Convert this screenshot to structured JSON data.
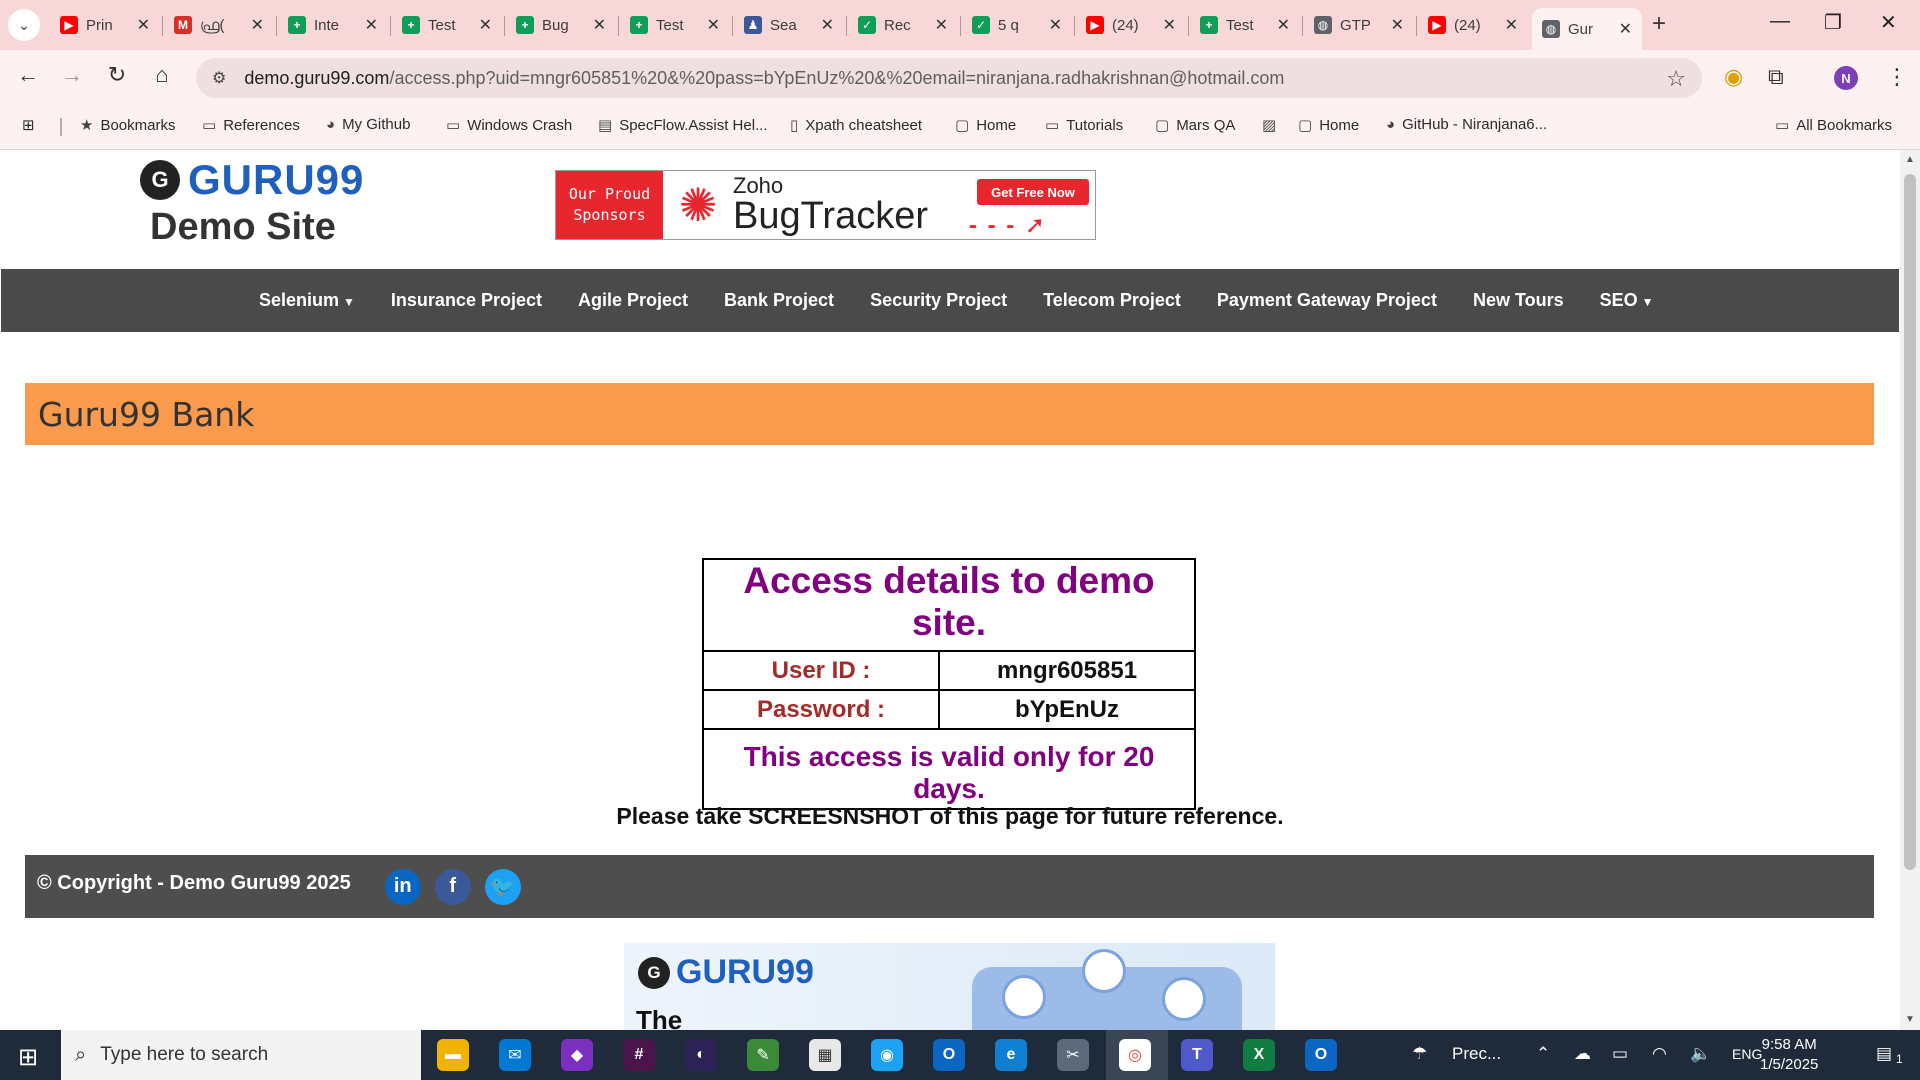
{
  "browser": {
    "tabs": [
      {
        "label": "Prin",
        "icon": "youtube-icon",
        "color": "#ff0000"
      },
      {
        "label": "ഫ്ര(",
        "icon": "gmail-icon",
        "color": "#d93025"
      },
      {
        "label": "Inte",
        "icon": "sheets-icon",
        "color": "#0f9d58"
      },
      {
        "label": "Test",
        "icon": "sheets-icon",
        "color": "#0f9d58"
      },
      {
        "label": "Bug",
        "icon": "sheets-icon",
        "color": "#0f9d58"
      },
      {
        "label": "Test",
        "icon": "sheets-icon",
        "color": "#0f9d58"
      },
      {
        "label": "Sea",
        "icon": "person-icon",
        "color": "#3b5998"
      },
      {
        "label": "Rec",
        "icon": "quiz-icon",
        "color": "#0f9d58"
      },
      {
        "label": "5 q",
        "icon": "quiz-icon",
        "color": "#0f9d58"
      },
      {
        "label": "(24)",
        "icon": "youtube-icon",
        "color": "#ff0000"
      },
      {
        "label": "Test",
        "icon": "sheets-icon",
        "color": "#0f9d58"
      },
      {
        "label": "GTP",
        "icon": "globe-icon",
        "color": "#5f6368"
      },
      {
        "label": "(24)",
        "icon": "youtube-icon",
        "color": "#ff0000"
      },
      {
        "label": "Gur",
        "icon": "globe-icon",
        "color": "#5f6368"
      }
    ],
    "url_host": "demo.guru99.com",
    "url_rest": "/access.php?uid=mngr605851%20&%20pass=bYpEnUz%20&%20email=niranjana.radhakrishnan@hotmail.com",
    "profile_initial": "N",
    "bookmarks": [
      {
        "label": "Bookmarks",
        "icon": "star-icon"
      },
      {
        "label": "References",
        "icon": "folder-icon"
      },
      {
        "label": "My Github",
        "icon": "github-icon"
      },
      {
        "label": "Windows Crash",
        "icon": "folder-icon"
      },
      {
        "label": "SpecFlow.Assist Hel...",
        "icon": "doc-icon"
      },
      {
        "label": "Xpath cheatsheet",
        "icon": "bookmark-icon"
      },
      {
        "label": "Home",
        "icon": "page-icon"
      },
      {
        "label": "Tutorials",
        "icon": "folder-icon"
      },
      {
        "label": "Mars QA",
        "icon": "page-icon"
      },
      {
        "label": "",
        "icon": "image-icon"
      },
      {
        "label": "Home",
        "icon": "page-icon"
      },
      {
        "label": "GitHub - Niranjana6...",
        "icon": "github-icon"
      }
    ],
    "all_bookmarks": "All Bookmarks"
  },
  "site": {
    "logo_text": "GURU99",
    "logo_sub": "Demo Site",
    "sponsor": {
      "left_text_1": "Our Proud",
      "left_text_2": "Sponsors",
      "brand": "Zoho",
      "product": "BugTracker",
      "cta": "Get Free Now"
    },
    "nav": [
      {
        "label": "Selenium",
        "dropdown": true
      },
      {
        "label": "Insurance Project",
        "dropdown": false
      },
      {
        "label": "Agile Project",
        "dropdown": false
      },
      {
        "label": "Bank Project",
        "dropdown": false
      },
      {
        "label": "Security Project",
        "dropdown": false
      },
      {
        "label": "Telecom Project",
        "dropdown": false
      },
      {
        "label": "Payment Gateway Project",
        "dropdown": false
      },
      {
        "label": "New Tours",
        "dropdown": false
      },
      {
        "label": "SEO",
        "dropdown": true
      }
    ],
    "bank_title": "Guru99 Bank",
    "access": {
      "heading": "Access details to demo site.",
      "user_id_label": "User ID :",
      "user_id_value": "mngr605851",
      "password_label": "Password :",
      "password_value": "bYpEnUz",
      "validity": "This access is valid only for 20 days."
    },
    "screenshot_note": "Please take SCREESNSHOT of this page for future reference.",
    "copyright": "© Copyright - Demo Guru99 2025",
    "promo": {
      "logo_text": "GURU99",
      "headline_start": "The"
    }
  },
  "taskbar": {
    "search_placeholder": "Type here to search",
    "weather": "Prec...",
    "language": "ENG",
    "time": "9:58 AM",
    "date": "1/5/2025",
    "notification_count": "1"
  },
  "colors": {
    "nav_bg": "#4a4a4a",
    "banner_orange": "#f99a4d",
    "heading_purple": "#800080",
    "label_brown": "#a52a2a",
    "logo_blue": "#1f5fc0"
  }
}
